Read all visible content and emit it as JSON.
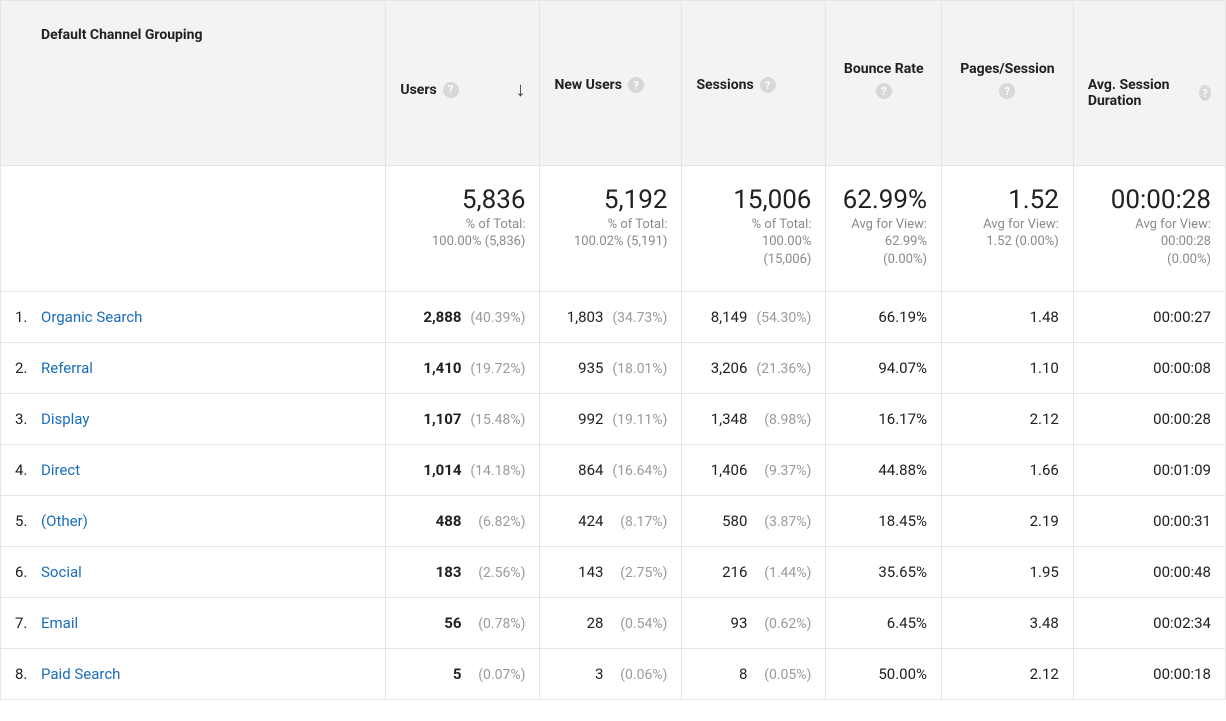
{
  "headers": {
    "dimension": "Default Channel Grouping",
    "users": "Users",
    "new_users": "New Users",
    "sessions": "Sessions",
    "bounce_rate": "Bounce Rate",
    "pages_session": "Pages/Session",
    "avg_duration": "Avg. Session Duration"
  },
  "icons": {
    "help": "?",
    "sort_desc": "↓"
  },
  "summary": {
    "users": {
      "value": "5,836",
      "sub1": "% of Total:",
      "sub2": "100.00% (5,836)"
    },
    "new_users": {
      "value": "5,192",
      "sub1": "% of Total:",
      "sub2": "100.02% (5,191)"
    },
    "sessions": {
      "value": "15,006",
      "sub1": "% of Total:",
      "sub2": "100.00%",
      "sub3": "(15,006)"
    },
    "bounce_rate": {
      "value": "62.99%",
      "sub1": "Avg for View:",
      "sub2": "62.99%",
      "sub3": "(0.00%)"
    },
    "pages_session": {
      "value": "1.52",
      "sub1": "Avg for View:",
      "sub2": "1.52 (0.00%)"
    },
    "avg_duration": {
      "value": "00:00:28",
      "sub1": "Avg for View:",
      "sub2": "00:00:28",
      "sub3": "(0.00%)"
    }
  },
  "rows": [
    {
      "n": "1.",
      "channel": "Organic Search",
      "users": "2,888",
      "users_pct": "(40.39%)",
      "new": "1,803",
      "new_pct": "(34.73%)",
      "sess": "8,149",
      "sess_pct": "(54.30%)",
      "bounce": "66.19%",
      "pages": "1.48",
      "dur": "00:00:27"
    },
    {
      "n": "2.",
      "channel": "Referral",
      "users": "1,410",
      "users_pct": "(19.72%)",
      "new": "935",
      "new_pct": "(18.01%)",
      "sess": "3,206",
      "sess_pct": "(21.36%)",
      "bounce": "94.07%",
      "pages": "1.10",
      "dur": "00:00:08"
    },
    {
      "n": "3.",
      "channel": "Display",
      "users": "1,107",
      "users_pct": "(15.48%)",
      "new": "992",
      "new_pct": "(19.11%)",
      "sess": "1,348",
      "sess_pct": "(8.98%)",
      "bounce": "16.17%",
      "pages": "2.12",
      "dur": "00:00:28"
    },
    {
      "n": "4.",
      "channel": "Direct",
      "users": "1,014",
      "users_pct": "(14.18%)",
      "new": "864",
      "new_pct": "(16.64%)",
      "sess": "1,406",
      "sess_pct": "(9.37%)",
      "bounce": "44.88%",
      "pages": "1.66",
      "dur": "00:01:09"
    },
    {
      "n": "5.",
      "channel": "(Other)",
      "users": "488",
      "users_pct": "(6.82%)",
      "new": "424",
      "new_pct": "(8.17%)",
      "sess": "580",
      "sess_pct": "(3.87%)",
      "bounce": "18.45%",
      "pages": "2.19",
      "dur": "00:00:31"
    },
    {
      "n": "6.",
      "channel": "Social",
      "users": "183",
      "users_pct": "(2.56%)",
      "new": "143",
      "new_pct": "(2.75%)",
      "sess": "216",
      "sess_pct": "(1.44%)",
      "bounce": "35.65%",
      "pages": "1.95",
      "dur": "00:00:48"
    },
    {
      "n": "7.",
      "channel": "Email",
      "users": "56",
      "users_pct": "(0.78%)",
      "new": "28",
      "new_pct": "(0.54%)",
      "sess": "93",
      "sess_pct": "(0.62%)",
      "bounce": "6.45%",
      "pages": "3.48",
      "dur": "00:02:34"
    },
    {
      "n": "8.",
      "channel": "Paid Search",
      "users": "5",
      "users_pct": "(0.07%)",
      "new": "3",
      "new_pct": "(0.06%)",
      "sess": "8",
      "sess_pct": "(0.05%)",
      "bounce": "50.00%",
      "pages": "2.12",
      "dur": "00:00:18"
    }
  ]
}
